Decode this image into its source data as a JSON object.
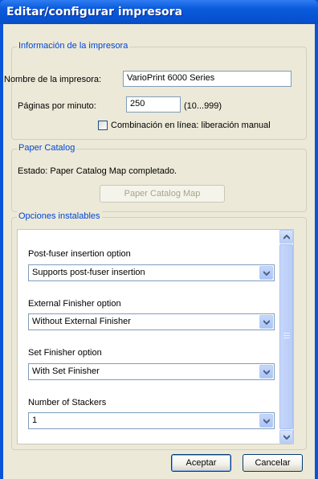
{
  "window": {
    "title": "Editar/configurar impresora"
  },
  "printer_info": {
    "legend": "Información de la impresora",
    "name_label": "Nombre de la impresora:",
    "name_value": "VarioPrint 6000 Series",
    "ppm_label": "Páginas por minuto:",
    "ppm_value": "250",
    "ppm_range": "(10...999)",
    "inline_label": "Combinación en línea: liberación manual",
    "inline_checked": false
  },
  "paper_catalog": {
    "legend": "Paper Catalog",
    "status": "Estado: Paper Catalog Map completado.",
    "button": "Paper Catalog Map"
  },
  "installable": {
    "legend": "Opciones instalables",
    "options": [
      {
        "label": "Post-fuser insertion option",
        "value": "Supports post-fuser insertion"
      },
      {
        "label": "External Finisher option",
        "value": "Without External Finisher"
      },
      {
        "label": "Set Finisher option",
        "value": "With Set Finisher"
      },
      {
        "label": "Number of Stackers",
        "value": "1"
      }
    ]
  },
  "buttons": {
    "ok": "Aceptar",
    "cancel": "Cancelar"
  },
  "colors": {
    "title_bar": "#0654d4",
    "legend_text": "#0046d5",
    "dialog_bg": "#ece9d8"
  }
}
